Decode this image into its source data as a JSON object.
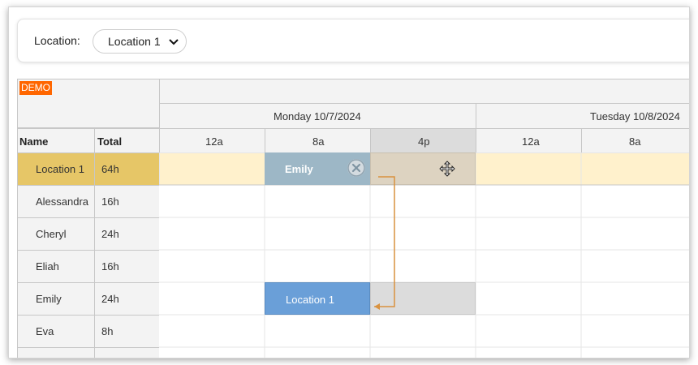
{
  "toolbar": {
    "location_label": "Location:",
    "location_value": "Location 1"
  },
  "scheduler": {
    "demo_badge": "DEMO",
    "days": [
      "Monday 10/7/2024",
      "Tuesday 10/8/2024"
    ],
    "hours": [
      "12a",
      "8a",
      "4p",
      "12a",
      "8a"
    ],
    "col_name": "Name",
    "col_total": "Total",
    "rows": [
      {
        "name": "Location 1",
        "total": "64h"
      },
      {
        "name": "Alessandra",
        "total": "16h"
      },
      {
        "name": "Cheryl",
        "total": "24h"
      },
      {
        "name": "Eliah",
        "total": "16h"
      },
      {
        "name": "Emily",
        "total": "24h"
      },
      {
        "name": "Eva",
        "total": "8h"
      }
    ],
    "events": {
      "emily_on_location": "Emily",
      "location_on_emily": "Location 1"
    }
  },
  "colors": {
    "demo": "#ff6600",
    "highlight_row": "#fff1cc",
    "location_head": "#e6c667",
    "event_blue": "#6a9fd8",
    "event_gray_blue": "#9db7c6",
    "link": "#d9923f"
  },
  "icons": [
    "chevron-down-icon",
    "close-icon",
    "move-icon"
  ]
}
